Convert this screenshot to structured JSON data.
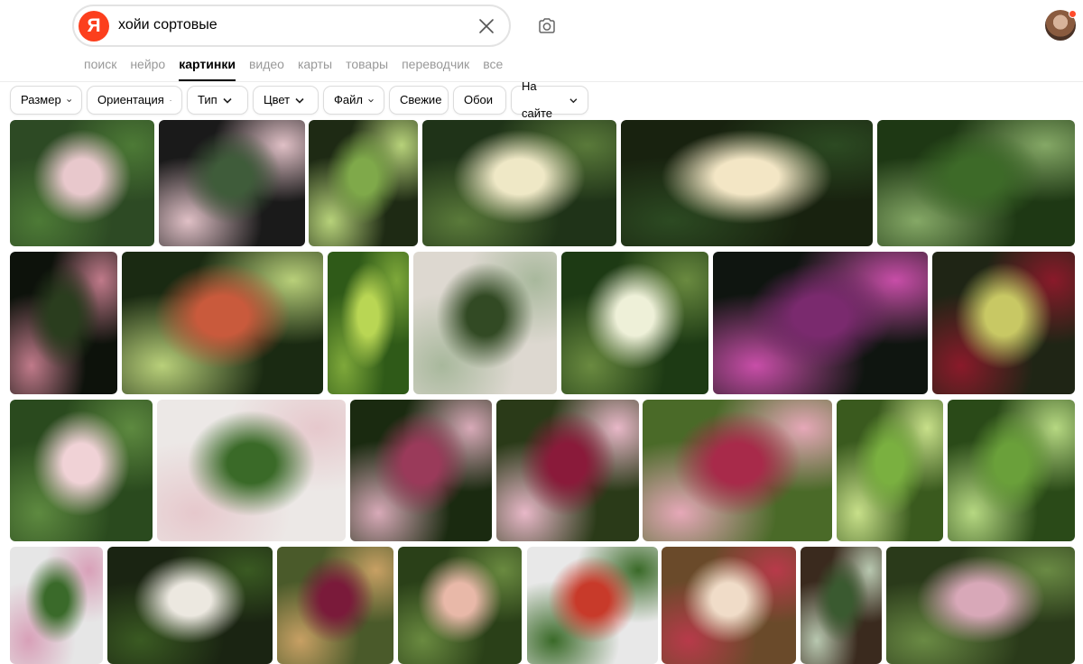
{
  "search": {
    "logo_letter": "Я",
    "query": "хойи сортовые"
  },
  "nav": {
    "tabs": [
      "поиск",
      "нейро",
      "картинки",
      "видео",
      "карты",
      "товары",
      "переводчик",
      "все"
    ],
    "active": 2
  },
  "filters": [
    {
      "label": "Размер",
      "dropdown": true
    },
    {
      "label": "Ориентация",
      "dropdown": true
    },
    {
      "label": "Тип",
      "dropdown": true
    },
    {
      "label": "Цвет",
      "dropdown": true
    },
    {
      "label": "Файл",
      "dropdown": true
    },
    {
      "label": "Свежие",
      "dropdown": false
    },
    {
      "label": "Обои",
      "dropdown": false
    },
    {
      "label": "На сайте",
      "dropdown": true
    }
  ],
  "colors": {
    "accent": "#fc3f1d",
    "text_muted": "#999999"
  },
  "results": [
    {
      "icon": "pink-hoya-flowers-image",
      "colors": [
        "#2d4a24",
        "#e8c8cc",
        "#4d7a36"
      ]
    },
    {
      "icon": "hoya-potted-plant-image",
      "colors": [
        "#1a1a1a",
        "#3f5c3a",
        "#e0c0c6"
      ]
    },
    {
      "icon": "trailing-hoya-vine-image",
      "colors": [
        "#1e2a14",
        "#7fa94a",
        "#b7d27a"
      ]
    },
    {
      "icon": "cream-star-hoya-image",
      "colors": [
        "#1f3318",
        "#efe8c6",
        "#5a7a3a"
      ]
    },
    {
      "icon": "cream-hoya-cluster-image",
      "colors": [
        "#18220f",
        "#f3e6c5",
        "#2c4a22"
      ]
    },
    {
      "icon": "hoya-green-leaves-image",
      "colors": [
        "#1e3814",
        "#3d6a28",
        "#85a866"
      ]
    },
    {
      "icon": "dark-hoya-plant-image",
      "colors": [
        "#0d120b",
        "#2a3d1e",
        "#c07a8a"
      ]
    },
    {
      "icon": "red-green-hoya-image",
      "colors": [
        "#1a2a12",
        "#c95a3c",
        "#b9d07a"
      ]
    },
    {
      "icon": "lime-green-hoya-image",
      "colors": [
        "#2f5a18",
        "#b9d654",
        "#7ea83a"
      ]
    },
    {
      "icon": "hoya-houseplant-image",
      "colors": [
        "#ddd8d0",
        "#324a24",
        "#a8b89c"
      ]
    },
    {
      "icon": "white-star-hoya-image",
      "colors": [
        "#1d3a14",
        "#eef0d8",
        "#6a8a40"
      ]
    },
    {
      "icon": "purple-star-hoya-image",
      "colors": [
        "#0f1510",
        "#7a2a6e",
        "#c84ea8"
      ]
    },
    {
      "icon": "yellow-red-hoya-image",
      "colors": [
        "#1f2515",
        "#c8c864",
        "#8a1a2a"
      ]
    },
    {
      "icon": "pink-hoya-ball-image",
      "colors": [
        "#2a4a1e",
        "#f0d2d6",
        "#5e8a40"
      ]
    },
    {
      "icon": "hoya-white-flowers-image",
      "colors": [
        "#ece8e6",
        "#3a6a28",
        "#e6c8cc"
      ]
    },
    {
      "icon": "dark-pink-hoya-image",
      "colors": [
        "#1a2a10",
        "#9a3a5a",
        "#d8aab8"
      ]
    },
    {
      "icon": "maroon-hoya-image",
      "colors": [
        "#2a3a18",
        "#8a1a3a",
        "#e8b8c8"
      ]
    },
    {
      "icon": "magenta-hoya-image",
      "colors": [
        "#4a6a28",
        "#a82a4a",
        "#e6a8b8"
      ]
    },
    {
      "icon": "hoya-foliage-image",
      "colors": [
        "#3a5a1e",
        "#7ab040",
        "#c8e08a"
      ]
    },
    {
      "icon": "hoya-narrow-leaves-image",
      "colors": [
        "#2a4a18",
        "#6aa03a",
        "#b6d882"
      ]
    },
    {
      "icon": "hoya-trellis-image",
      "colors": [
        "#e6e6e6",
        "#3a6a2a",
        "#d8a0b8"
      ]
    },
    {
      "icon": "hoya-white-cluster-image",
      "colors": [
        "#1a2412",
        "#ece8e0",
        "#3a5a22"
      ]
    },
    {
      "icon": "burgundy-star-hoya-image",
      "colors": [
        "#4a5a2a",
        "#7a1a3a",
        "#c8a064"
      ]
    },
    {
      "icon": "peach-hoya-image",
      "colors": [
        "#2a4018",
        "#e8b8a8",
        "#6a8a40"
      ]
    },
    {
      "icon": "red-hoya-cluster-image",
      "colors": [
        "#e8e8e8",
        "#c83a2a",
        "#3a6a28"
      ]
    },
    {
      "icon": "pink-red-hoya-image",
      "colors": [
        "#6a4a2a",
        "#f0dcc8",
        "#b83a4a"
      ]
    },
    {
      "icon": "silver-leaf-hoya-image",
      "colors": [
        "#3a2a1e",
        "#3a5a30",
        "#b8c8b0"
      ]
    },
    {
      "icon": "hoya-small-leaves-image",
      "colors": [
        "#2a3a1a",
        "#d8a8b8",
        "#6a8a44"
      ]
    },
    {
      "icon": "orange-hoya-image",
      "colors": [
        "#6a2a14",
        "#e86a3a",
        "#f0c8a0"
      ]
    }
  ]
}
